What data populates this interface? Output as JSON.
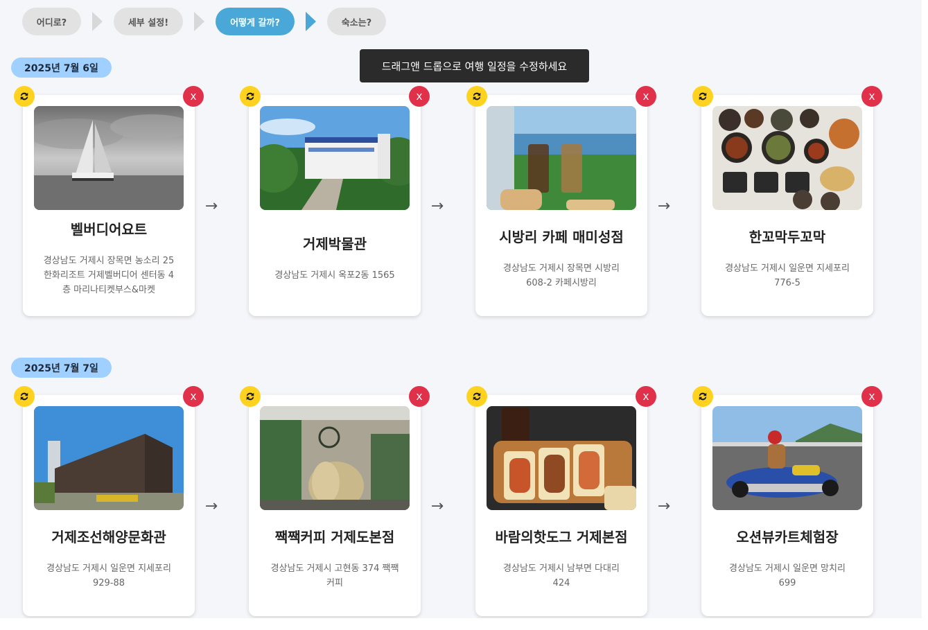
{
  "steps": [
    "어디로?",
    "세부 설정!",
    "어떻게 갈까?",
    "숙소는?"
  ],
  "tooltip": "드래그앤 드롭으로 여행 일정을 수정하세요",
  "days": [
    {
      "label": "2025년 7월 6일",
      "places": [
        {
          "name": "벨버디어요트",
          "address": "경상남도 거제시 장목면 농소리 25 한화리조트 거제벨버디어 센터동 4층 마리나티켓부스&마켓"
        },
        {
          "name": "거제박물관",
          "address": "경상남도 거제시 옥포2동 1565"
        },
        {
          "name": "시방리 카페 매미성점",
          "address": "경상남도 거제시 장목면 시방리 608-2 카페시방리"
        },
        {
          "name": "한꼬막두꼬막",
          "address": "경상남도 거제시 일운면 지세포리 776-5"
        }
      ]
    },
    {
      "label": "2025년 7월 7일",
      "places": [
        {
          "name": "거제조선해양문화관",
          "address": "경상남도 거제시 일운면 지세포리 929-88"
        },
        {
          "name": "짹짹커피 거제도본점",
          "address": "경상남도 거제시 고현동 374 짹짹커피"
        },
        {
          "name": "바람의핫도그 거제본점",
          "address": "경상남도 거제시 남부면 다대리 424"
        },
        {
          "name": "오션뷰카트체험장",
          "address": "경상남도 거제시 일운면 망치리 699"
        }
      ]
    }
  ],
  "delete_label": "x",
  "flow_arrow": "→",
  "icons": {
    "swap": "refresh-icon",
    "delete": "close-icon"
  },
  "colors": {
    "active_step": "#4aa8d8",
    "day_badge": "#9fd0ff",
    "swap": "#ffd21f",
    "delete": "#e0304a"
  }
}
